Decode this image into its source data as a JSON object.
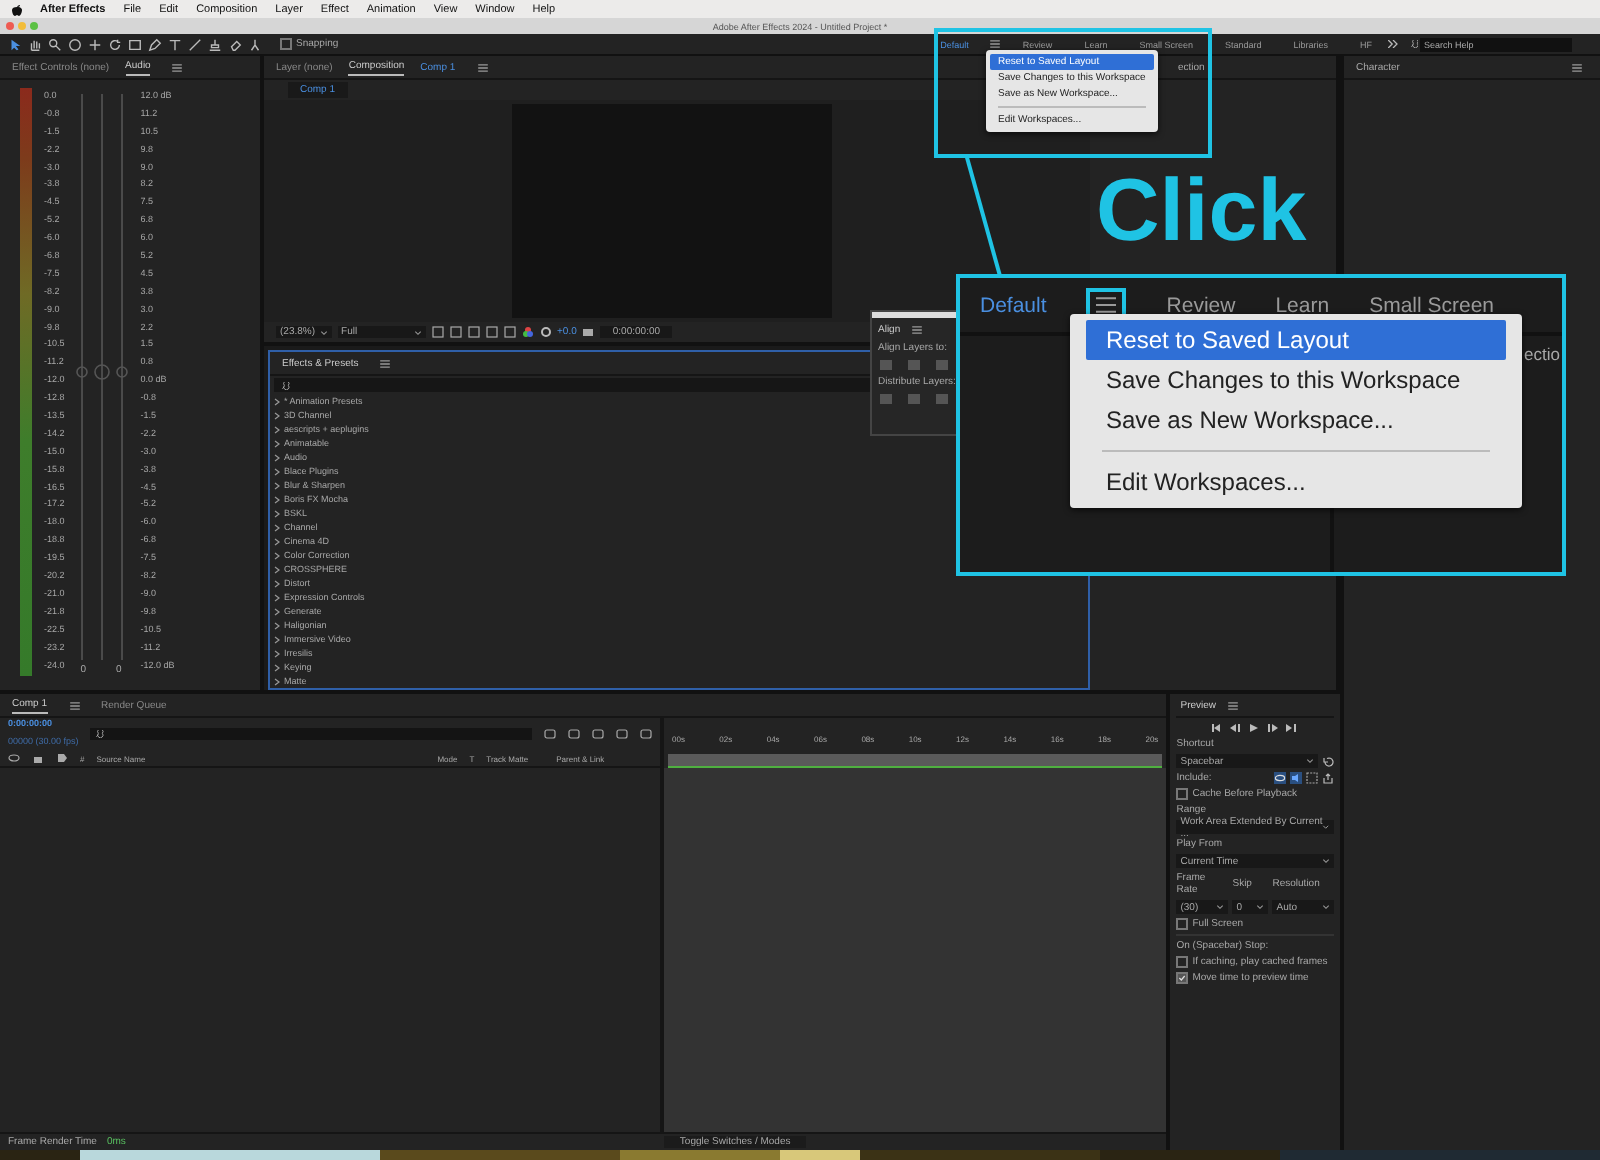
{
  "menubar": {
    "app": "After Effects",
    "items": [
      "File",
      "Edit",
      "Composition",
      "Layer",
      "Effect",
      "Animation",
      "View",
      "Window",
      "Help"
    ]
  },
  "window": {
    "title": "Adobe After Effects 2024 - Untitled Project *"
  },
  "toolbar": {
    "snapping": {
      "label": "Snapping",
      "checked": false
    }
  },
  "workspaces": [
    {
      "label": "Default",
      "selected": true
    },
    {
      "label": "Review",
      "selected": false
    },
    {
      "label": "Learn",
      "selected": false
    },
    {
      "label": "Small Screen",
      "selected": false
    },
    {
      "label": "Standard",
      "selected": false
    },
    {
      "label": "Libraries",
      "selected": false
    },
    {
      "label": "HF",
      "selected": false
    }
  ],
  "search_help": {
    "placeholder": "Search Help"
  },
  "audio_panel": {
    "tabs": [
      {
        "label": "Effect Controls (none)",
        "selected": false
      },
      {
        "label": "Audio",
        "selected": true
      }
    ],
    "left_scale": [
      "0.0",
      "-0.8",
      "-1.5",
      "-2.2",
      "-3.0",
      "-3.8",
      "-4.5",
      "-5.2",
      "-6.0",
      "-6.8",
      "-7.5",
      "-8.2",
      "-9.0",
      "-9.8",
      "-10.5",
      "-11.2",
      "-12.0",
      "-12.8",
      "-13.5",
      "-14.2",
      "-15.0",
      "-15.8",
      "-16.5",
      "-17.2",
      "-18.0",
      "-18.8",
      "-19.5",
      "-20.2",
      "-21.0",
      "-21.8",
      "-22.5",
      "-23.2",
      "-24.0"
    ],
    "right_scale": [
      "12.0 dB",
      "11.2",
      "10.5",
      "9.8",
      "9.0",
      "8.2",
      "7.5",
      "6.8",
      "6.0",
      "5.2",
      "4.5",
      "3.8",
      "3.0",
      "2.2",
      "1.5",
      "0.8",
      "0.0 dB",
      "-0.8",
      "-1.5",
      "-2.2",
      "-3.0",
      "-3.8",
      "-4.5",
      "-5.2",
      "-6.0",
      "-6.8",
      "-7.5",
      "-8.2",
      "-9.0",
      "-9.8",
      "-10.5",
      "-11.2",
      "-12.0 dB"
    ],
    "fader_values": [
      "0",
      "0"
    ]
  },
  "viewer": {
    "tabs": [
      {
        "label": "Layer (none)",
        "selected": false
      },
      {
        "label": "Composition",
        "selected": true
      }
    ],
    "comp_name": "Comp 1",
    "breadcrumb": "Comp 1",
    "zoom": "(23.8%)",
    "quality": "Full",
    "exposure": "+0.0",
    "timecode": "0:00:00:00"
  },
  "hidden_panel": {
    "title_fragment": "ection"
  },
  "character": {
    "title": "Character"
  },
  "effects_presets": {
    "title": "Effects & Presets",
    "items": [
      "* Animation Presets",
      "3D Channel",
      "aescripts + aeplugins",
      "Animatable",
      "Audio",
      "Blace Plugins",
      "Blur & Sharpen",
      "Boris FX Mocha",
      "BSKL",
      "Channel",
      "Cinema 4D",
      "Color Correction",
      "CROSSPHERE",
      "Distort",
      "Expression Controls",
      "Generate",
      "Haligonian",
      "Immersive Video",
      "Irresilis",
      "Keying",
      "Matte"
    ]
  },
  "align": {
    "title": "Align",
    "align_to": "Align Layers to:",
    "distribute": "Distribute Layers:"
  },
  "workspace_menu": {
    "groups": [
      [
        {
          "label": "Reset to Saved Layout",
          "selected": true
        },
        {
          "label": "Save Changes to this Workspace",
          "selected": false
        },
        {
          "label": "Save as New Workspace...",
          "selected": false
        }
      ],
      [
        {
          "label": "Edit Workspaces...",
          "selected": false
        }
      ]
    ]
  },
  "callout": {
    "caption": "Click",
    "workspaces": [
      {
        "label": "Default",
        "selected": true
      },
      {
        "label": "Review",
        "selected": false
      },
      {
        "label": "Learn",
        "selected": false
      },
      {
        "label": "Small Screen",
        "selected": false
      }
    ],
    "title_fragment": "ectio",
    "menu": {
      "groups": [
        [
          {
            "label": "Reset to Saved Layout",
            "selected": true
          },
          {
            "label": "Save Changes to this Workspace",
            "selected": false
          },
          {
            "label": "Save as New Workspace...",
            "selected": false
          }
        ],
        [
          {
            "label": "Edit Workspaces...",
            "selected": false
          }
        ]
      ]
    }
  },
  "timeline": {
    "tabs": [
      {
        "label": "Comp 1",
        "selected": true
      },
      {
        "label": "Render Queue",
        "selected": false
      }
    ],
    "timecode": "0:00:00:00",
    "frame_info": "00000 (30.00 fps)",
    "columns": [
      "#",
      "Source Name",
      "Mode",
      "T",
      "Track Matte",
      "Parent & Link"
    ],
    "ticks": [
      "00s",
      "02s",
      "04s",
      "06s",
      "08s",
      "10s",
      "12s",
      "14s",
      "16s",
      "18s",
      "20s"
    ],
    "render_label": "Frame Render Time",
    "render_value": "0ms",
    "toggle": "Toggle Switches / Modes"
  },
  "preview": {
    "title": "Preview",
    "shortcut_label": "Shortcut",
    "shortcut": "Spacebar",
    "include_label": "Include:",
    "cache": {
      "label": "Cache Before Playback",
      "checked": false
    },
    "range_label": "Range",
    "range": "Work Area Extended By Current ...",
    "play_from_label": "Play From",
    "play_from": "Current Time",
    "frame_rate_label": "Frame Rate",
    "skip_label": "Skip",
    "resolution_label": "Resolution",
    "frame_rate": "(30)",
    "skip": "0",
    "resolution": "Auto",
    "full_screen": {
      "label": "Full Screen",
      "checked": false
    },
    "stop_label": "On (Spacebar) Stop:",
    "stop_options": [
      {
        "label": "If caching, play cached frames",
        "checked": false
      },
      {
        "label": "Move time to preview time",
        "checked": true
      }
    ]
  }
}
